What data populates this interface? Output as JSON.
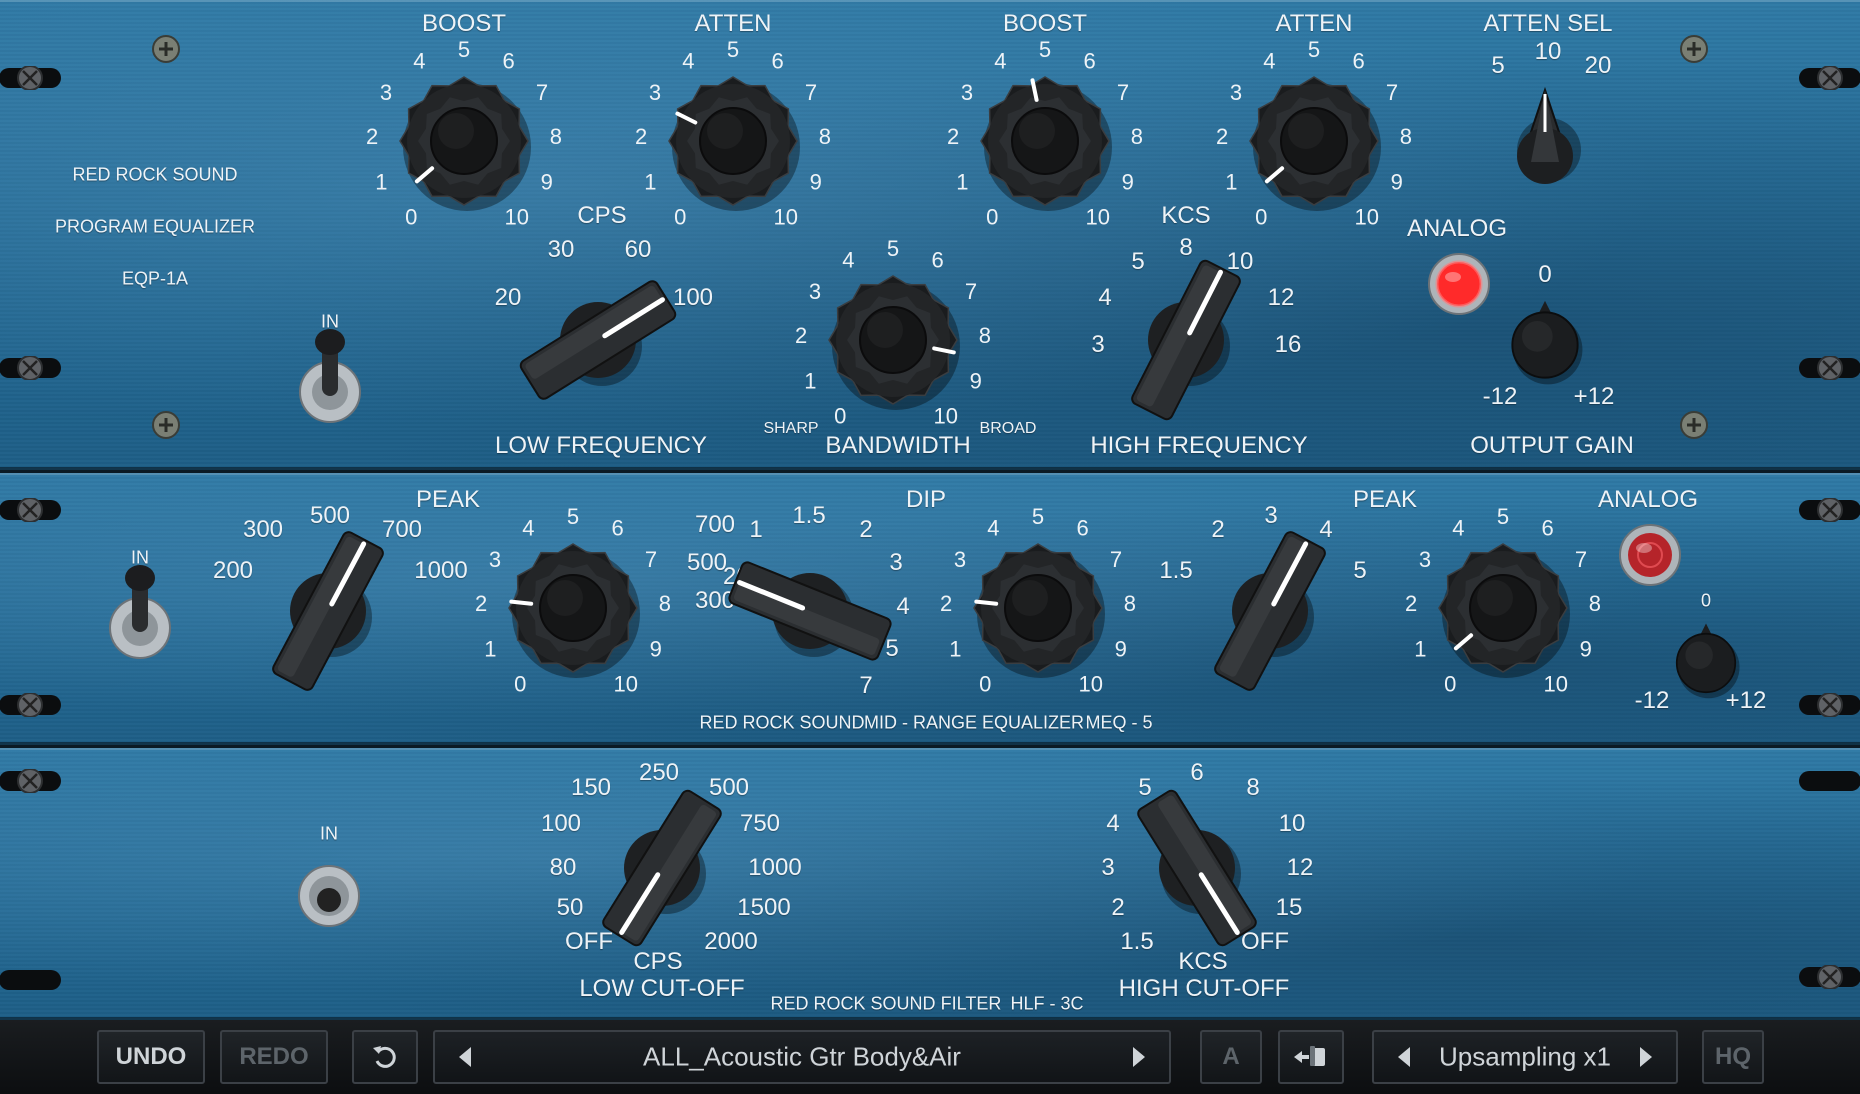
{
  "eqp": {
    "brand": "RED ROCK SOUND",
    "product": "PROGRAM EQUALIZER",
    "model": "EQP-1A",
    "in_label": "IN",
    "low_boost": {
      "title": "BOOST",
      "ticks": [
        "0",
        "1",
        "2",
        "3",
        "4",
        "5",
        "6",
        "7",
        "8",
        "9",
        "10"
      ],
      "value": 0.5
    },
    "low_atten": {
      "title": "ATTEN",
      "ticks": [
        "0",
        "1",
        "2",
        "3",
        "4",
        "5",
        "6",
        "7",
        "8",
        "9",
        "10"
      ],
      "value": 2.8
    },
    "high_boost": {
      "title": "BOOST",
      "ticks": [
        "0",
        "1",
        "2",
        "3",
        "4",
        "5",
        "6",
        "7",
        "8",
        "9",
        "10"
      ],
      "value": 4.6
    },
    "high_atten": {
      "title": "ATTEN",
      "ticks": [
        "0",
        "1",
        "2",
        "3",
        "4",
        "5",
        "6",
        "7",
        "8",
        "9",
        "10"
      ],
      "value": 0.5
    },
    "atten_sel": {
      "title": "ATTEN SEL",
      "options": [
        "5",
        "10",
        "20"
      ],
      "selected": "10"
    },
    "low_freq": {
      "unit": "CPS",
      "options": [
        "20",
        "30",
        "60",
        "100"
      ],
      "selected": "100",
      "title": "LOW FREQUENCY"
    },
    "bandwidth": {
      "title": "BANDWIDTH",
      "ticks": [
        "0",
        "1",
        "2",
        "3",
        "4",
        "5",
        "6",
        "7",
        "8",
        "9",
        "10"
      ],
      "sharp": "SHARP",
      "broad": "BROAD",
      "value": 8.5
    },
    "high_freq": {
      "unit": "KCS",
      "options": [
        "3",
        "4",
        "5",
        "8",
        "10",
        "12",
        "16"
      ],
      "selected": "10",
      "title": "HIGH FREQUENCY"
    },
    "analog": {
      "label": "ANALOG",
      "on": true
    },
    "output_gain": {
      "title": "OUTPUT GAIN",
      "zero": "0",
      "min": "-12",
      "max": "+12"
    }
  },
  "meq": {
    "in_label": "IN",
    "peak1_freq": {
      "title": "PEAK",
      "options": [
        "200",
        "300",
        "500",
        "700",
        "1000"
      ],
      "selected": "700"
    },
    "peak1_gain": {
      "ticks": [
        "0",
        "1",
        "2",
        "3",
        "4",
        "5",
        "6",
        "7",
        "8",
        "9",
        "10"
      ],
      "value": 2.1
    },
    "dip_freq": {
      "title": "DIP",
      "options": [
        "200",
        "300",
        "500",
        "700",
        "1",
        "1.5",
        "2",
        "3",
        "4",
        "5",
        "7"
      ],
      "selected": "300"
    },
    "dip_gain": {
      "ticks": [
        "0",
        "1",
        "2",
        "3",
        "4",
        "5",
        "6",
        "7",
        "8",
        "9",
        "10"
      ],
      "value": 2.1
    },
    "peak2_freq": {
      "title": "PEAK",
      "options": [
        "1.5",
        "2",
        "3",
        "4",
        "5"
      ],
      "selected": "4"
    },
    "peak2_gain": {
      "ticks": [
        "0",
        "1",
        "2",
        "3",
        "4",
        "5",
        "6",
        "7",
        "8",
        "9",
        "10"
      ],
      "value": 0.5
    },
    "analog": {
      "label": "ANALOG",
      "on": false
    },
    "output": {
      "zero": "0",
      "min": "-12",
      "max": "+12"
    },
    "footer": {
      "brand": "RED ROCK SOUND",
      "name": "MID - RANGE EQUALIZER",
      "model": "MEQ - 5"
    }
  },
  "hlf": {
    "in_label": "IN",
    "low_cut": {
      "options": [
        "OFF",
        "50",
        "80",
        "100",
        "150",
        "250",
        "500",
        "750",
        "1000",
        "1500",
        "2000"
      ],
      "selected": "OFF",
      "unit": "CPS",
      "title": "LOW CUT-OFF"
    },
    "high_cut": {
      "options": [
        "1.5",
        "2",
        "3",
        "4",
        "5",
        "6",
        "8",
        "10",
        "12",
        "15",
        "OFF"
      ],
      "selected": "OFF",
      "unit": "KCS",
      "title": "HIGH CUT-OFF"
    },
    "footer": {
      "brand": "RED ROCK SOUND",
      "name": "FILTER",
      "model": "HLF - 3C"
    }
  },
  "toolbar": {
    "undo": "UNDO",
    "redo": "REDO",
    "undo_history_icon": "rotate-ccw-icon",
    "preset": "ALL_Acoustic Gtr Body&Air",
    "ab": "A",
    "copy_icon": "copy-settings-icon",
    "upsampling": "Upsampling x1",
    "hq": "HQ"
  }
}
